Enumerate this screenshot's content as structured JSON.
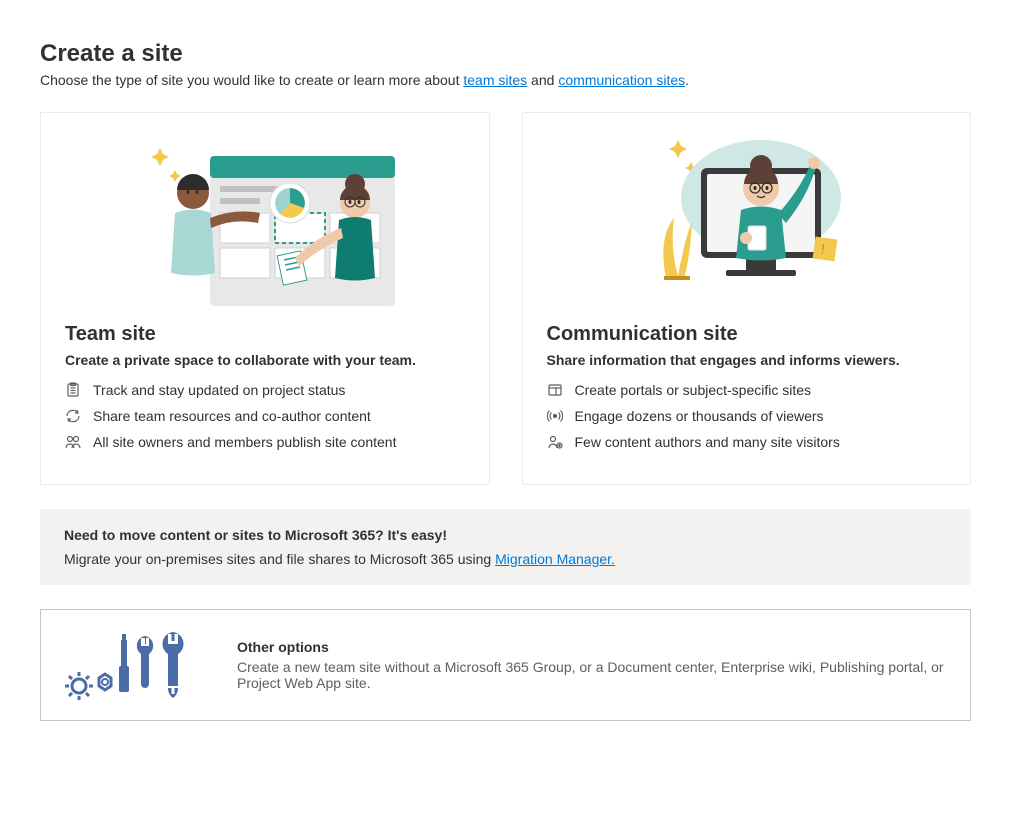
{
  "header": {
    "title": "Create a site",
    "subtitle_prefix": "Choose the type of site you would like to create or learn more about ",
    "link1": "team sites",
    "subtitle_mid": " and ",
    "link2": "communication sites",
    "subtitle_suffix": "."
  },
  "cards": {
    "team": {
      "title": "Team site",
      "tagline": "Create a private space to collaborate with your team.",
      "features": [
        "Track and stay updated on project status",
        "Share team resources and co-author content",
        "All site owners and members publish site content"
      ]
    },
    "comm": {
      "title": "Communication site",
      "tagline": "Share information that engages and informs viewers.",
      "features": [
        "Create portals or subject-specific sites",
        "Engage dozens or thousands of viewers",
        "Few content authors and many site visitors"
      ]
    }
  },
  "migrate": {
    "title": "Need to move content or sites to Microsoft 365? It's easy!",
    "text_prefix": "Migrate your on-premises sites and file shares to Microsoft 365 using ",
    "link": "Migration Manager."
  },
  "other": {
    "title": "Other options",
    "text": "Create a new team site without a Microsoft 365 Group, or a Document center, Enterprise wiki, Publishing portal, or Project Web App site."
  }
}
